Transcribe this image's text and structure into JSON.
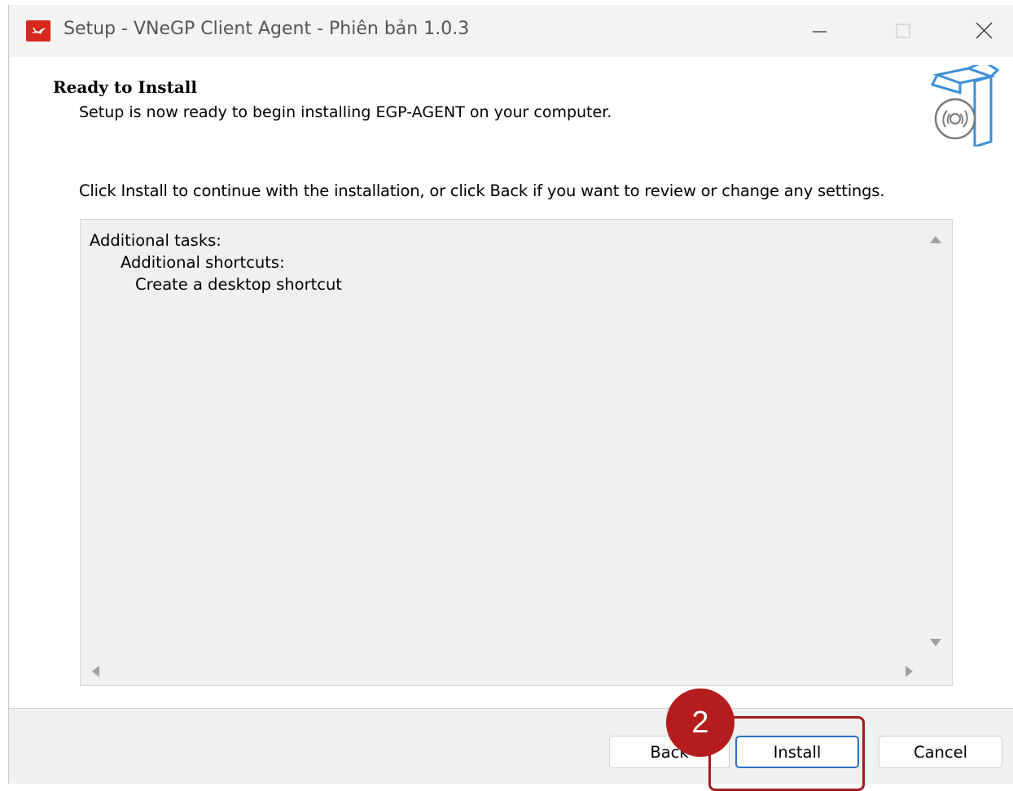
{
  "window": {
    "title": "Setup - VNeGP Client Agent - Phiên bản 1.0.3",
    "app_icon": "vnegp-logo-icon",
    "controls": {
      "minimize": "minimize-icon",
      "maximize": "maximize-icon",
      "close": "close-icon"
    }
  },
  "header": {
    "title": "Ready to Install",
    "subtitle": "Setup is now ready to begin installing EGP-AGENT on your computer.",
    "icon": "install-box-icon"
  },
  "main": {
    "instruction": "Click Install to continue with the installation, or click Back if you want to review or change any settings.",
    "memo_lines": [
      "Additional tasks:",
      "Additional shortcuts:",
      "Create a desktop shortcut"
    ]
  },
  "footer": {
    "back_label": "Back",
    "install_label": "Install",
    "cancel_label": "Cancel"
  },
  "annotation": {
    "step_number": "2",
    "color": "#b51d1d"
  }
}
